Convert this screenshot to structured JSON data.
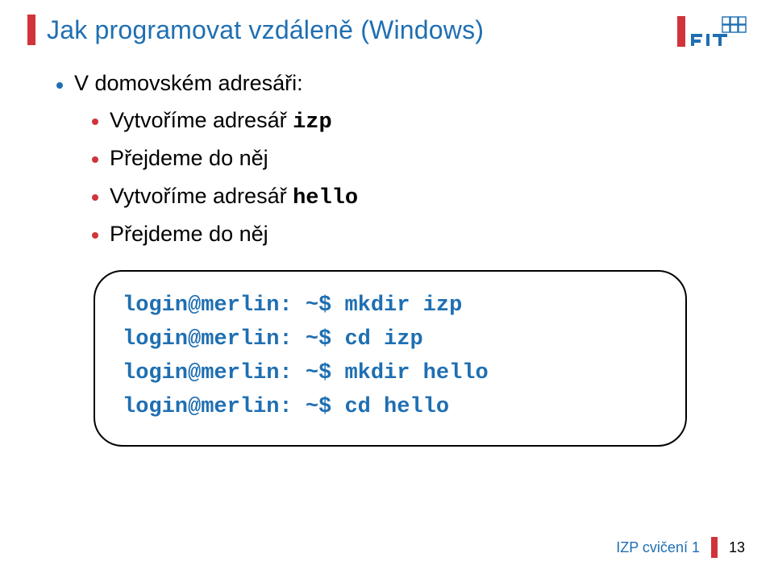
{
  "title": "Jak programovat vzdáleně (Windows)",
  "bullets": {
    "l1": "V domovském adresáři:",
    "sub": [
      {
        "text": "Vytvoříme adresář ",
        "code": "izp"
      },
      {
        "text": "Přejdeme do něj",
        "code": ""
      },
      {
        "text": "Vytvoříme adresář ",
        "code": "hello"
      },
      {
        "text": "Přejdeme do něj",
        "code": ""
      }
    ]
  },
  "code": {
    "l1": "login@merlin: ~$ mkdir izp",
    "l2": "login@merlin: ~$ cd izp",
    "l3": "login@merlin: ~$ mkdir hello",
    "l4": "login@merlin: ~$ cd hello"
  },
  "footer": {
    "label": "IZP cvičení 1",
    "page": "13"
  }
}
